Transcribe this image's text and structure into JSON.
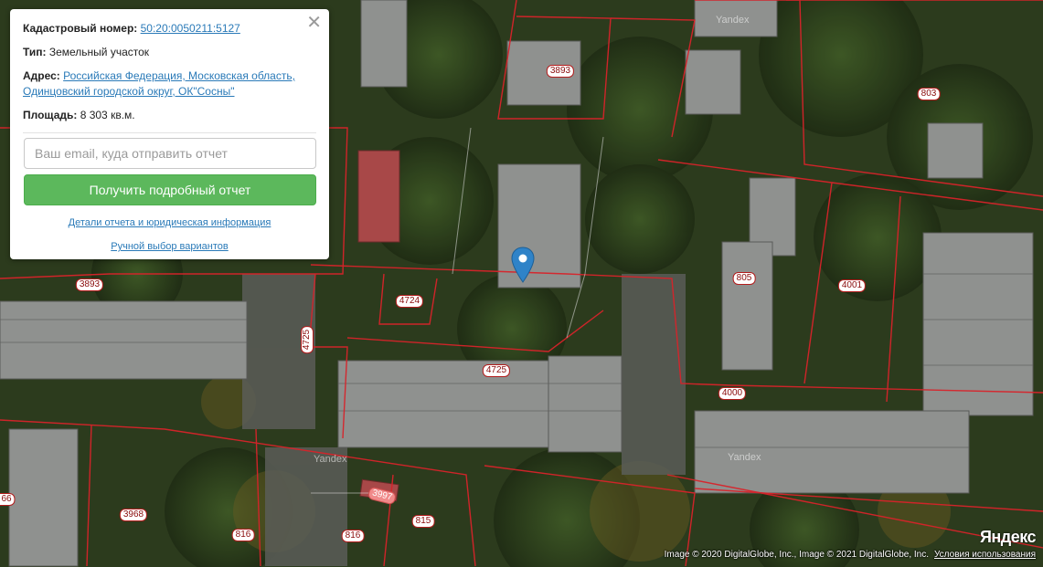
{
  "popup": {
    "cadastral_label": "Кадастровый номер:",
    "cadastral_number": "50:20:0050211:5127",
    "type_label": "Тип:",
    "type_value": "Земельный участок",
    "address_label": "Адрес:",
    "address_value": "Российская Федерация, Московская область, Одинцовский городской округ, ОК\"Сосны\"",
    "area_label": "Площадь:",
    "area_value": "8 303 кв.м.",
    "email_placeholder": "Ваш email, куда отправить отчет",
    "report_button": "Получить подробный отчет",
    "details_link": "Детали отчета и юридическая информация",
    "manual_link": "Ручной выбор вариантов",
    "close_icon": "close-icon"
  },
  "map": {
    "parcel_labels": [
      {
        "id": "3893-top",
        "text": "3893"
      },
      {
        "id": "803",
        "text": "803"
      },
      {
        "id": "3893-left",
        "text": "3893"
      },
      {
        "id": "4724",
        "text": "4724"
      },
      {
        "id": "4725-v",
        "text": "4725"
      },
      {
        "id": "4725",
        "text": "4725"
      },
      {
        "id": "805",
        "text": "805"
      },
      {
        "id": "4001",
        "text": "4001"
      },
      {
        "id": "4000",
        "text": "4000"
      },
      {
        "id": "3997",
        "text": "3997"
      },
      {
        "id": "3968",
        "text": "3968"
      },
      {
        "id": "816-a",
        "text": "816"
      },
      {
        "id": "816-b",
        "text": "816"
      },
      {
        "id": "815",
        "text": "815"
      },
      {
        "id": "66",
        "text": "66"
      }
    ],
    "watermarks": [
      "Yandex",
      "Yandex",
      "Yandex"
    ],
    "logo": "Яндекс",
    "copyright": "Image © 2020 DigitalGlobe, Inc., Image © 2021 DigitalGlobe, Inc.",
    "terms_link": "Условия использования",
    "marker_icon": "map-pin-icon",
    "colors": {
      "parcel_border": "#d8232a",
      "button": "#5cb85c",
      "link": "#2a7ab8"
    }
  }
}
